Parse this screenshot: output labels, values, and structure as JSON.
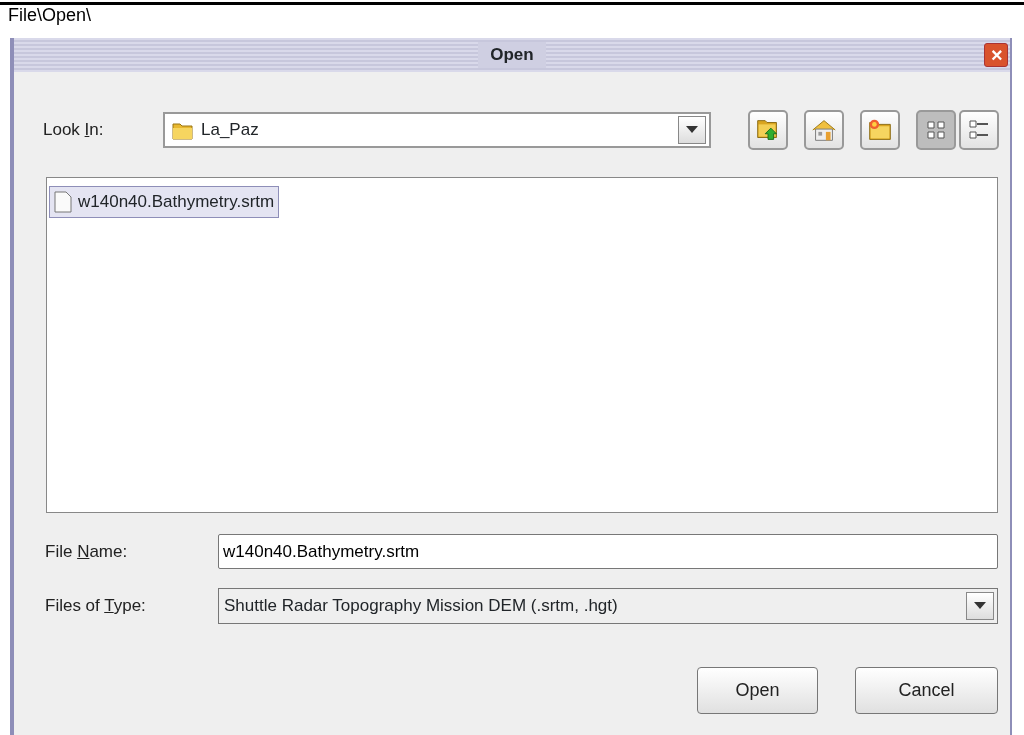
{
  "caption": "File\\Open\\",
  "window": {
    "title": "Open",
    "close": "×"
  },
  "look_in": {
    "label": {
      "before": "Look ",
      "mnemonic": "I",
      "after": "n:"
    },
    "value": "La_Paz"
  },
  "toolbar": [
    {
      "kind": "up"
    },
    {
      "kind": "home"
    },
    {
      "kind": "newfolder"
    }
  ],
  "views": [
    {
      "kind": "list",
      "selected": true
    },
    {
      "kind": "details",
      "selected": false
    }
  ],
  "files": [
    {
      "name": "w140n40.Bathymetry.srtm",
      "selected": true
    }
  ],
  "file_name": {
    "label": {
      "before": "File ",
      "mnemonic": "N",
      "after": "ame:"
    },
    "value": "w140n40.Bathymetry.srtm"
  },
  "file_type": {
    "label": {
      "before": "Files of ",
      "mnemonic": "T",
      "after": "ype:"
    },
    "value": "Shuttle Radar Topography Mission DEM (.srtm, .hgt)"
  },
  "buttons": [
    "Open",
    "Cancel"
  ]
}
